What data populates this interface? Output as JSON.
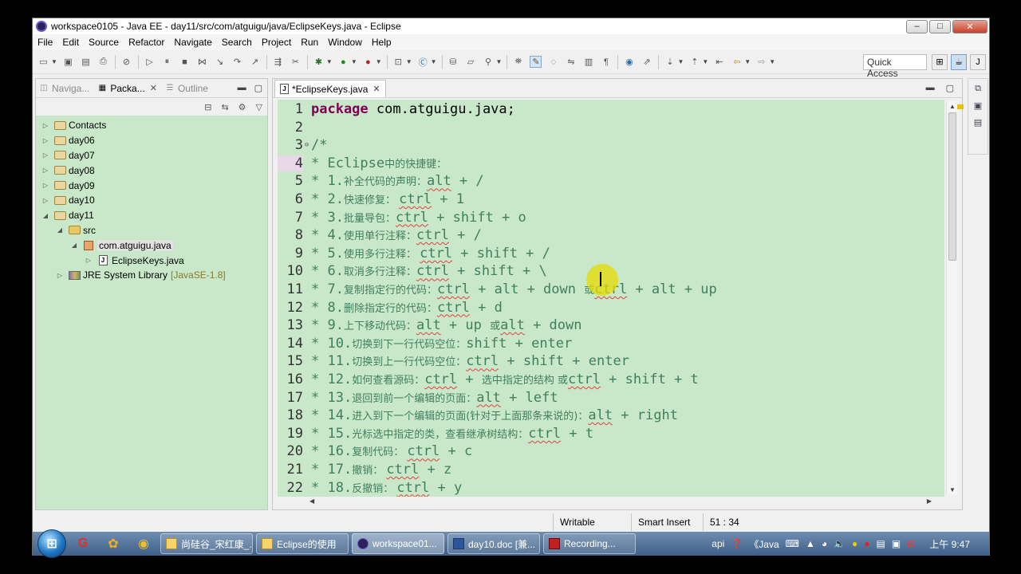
{
  "window": {
    "title": "workspace0105 - Java EE - day11/src/com/atguigu/java/EclipseKeys.java - Eclipse",
    "controls": [
      "–",
      "□",
      "✕"
    ]
  },
  "menu": [
    "File",
    "Edit",
    "Source",
    "Refactor",
    "Navigate",
    "Search",
    "Project",
    "Run",
    "Window",
    "Help"
  ],
  "toolbar": {
    "quick_access": "Quick Access"
  },
  "left_tabs": [
    {
      "label": "Naviga...",
      "icon": "navigator-icon",
      "active": false
    },
    {
      "label": "Packa...",
      "icon": "package-explorer-icon",
      "active": true
    },
    {
      "label": "Outline",
      "icon": "outline-icon",
      "active": false
    }
  ],
  "tree": [
    {
      "label": "Contacts",
      "type": "project",
      "twisty": "▷",
      "indent": 0
    },
    {
      "label": "day06",
      "type": "project",
      "twisty": "▷",
      "indent": 0
    },
    {
      "label": "day07",
      "type": "project",
      "twisty": "▷",
      "indent": 0
    },
    {
      "label": "day08",
      "type": "project",
      "twisty": "▷",
      "indent": 0
    },
    {
      "label": "day09",
      "type": "project",
      "twisty": "▷",
      "indent": 0
    },
    {
      "label": "day10",
      "type": "project",
      "twisty": "▷",
      "indent": 0
    },
    {
      "label": "day11",
      "type": "project",
      "twisty": "◢",
      "indent": 0
    },
    {
      "label": "src",
      "type": "folder",
      "twisty": "◢",
      "indent": 1
    },
    {
      "label": "com.atguigu.java",
      "type": "package",
      "twisty": "◢",
      "indent": 2,
      "selected": true
    },
    {
      "label": "EclipseKeys.java",
      "type": "java",
      "twisty": "▷",
      "indent": 3
    },
    {
      "label": "JRE System Library",
      "type": "library",
      "twisty": "▷",
      "indent": 1,
      "suffix": "[JavaSE-1.8]"
    }
  ],
  "editor": {
    "tab_label": "*EclipseKeys.java",
    "lines": [
      {
        "n": "1",
        "parts": [
          [
            "kw",
            "package"
          ],
          [
            "pl",
            " com.atguigu.java;"
          ]
        ]
      },
      {
        "n": "2",
        "parts": []
      },
      {
        "n": "3",
        "fold": "⊖",
        "parts": [
          [
            "c",
            "/*"
          ]
        ]
      },
      {
        "n": "4",
        "parts": [
          [
            "c",
            " * Eclipse"
          ],
          [
            "cj",
            "中的快捷键："
          ]
        ]
      },
      {
        "n": "5",
        "parts": [
          [
            "c",
            " * 1."
          ],
          [
            "cj",
            "补全代码的声明："
          ],
          [
            "sq",
            "alt"
          ],
          [
            "c",
            " + /"
          ]
        ]
      },
      {
        "n": "6",
        "parts": [
          [
            "c",
            " * 2."
          ],
          [
            "cj",
            "快速修复： "
          ],
          [
            "sq",
            "ctrl"
          ],
          [
            "c",
            " + 1"
          ]
        ]
      },
      {
        "n": "7",
        "parts": [
          [
            "c",
            " * 3."
          ],
          [
            "cj",
            "批量导包："
          ],
          [
            "sq",
            "ctrl"
          ],
          [
            "c",
            " + shift + o"
          ]
        ]
      },
      {
        "n": "8",
        "parts": [
          [
            "c",
            " * 4."
          ],
          [
            "cj",
            "使用单行注释："
          ],
          [
            "sq",
            "ctrl"
          ],
          [
            "c",
            " + /"
          ]
        ]
      },
      {
        "n": "9",
        "parts": [
          [
            "c",
            " * 5."
          ],
          [
            "cj",
            "使用多行注释： "
          ],
          [
            "sq",
            "ctrl"
          ],
          [
            "c",
            " + shift + /"
          ]
        ]
      },
      {
        "n": "10",
        "parts": [
          [
            "c",
            " * 6."
          ],
          [
            "cj",
            "取消多行注释："
          ],
          [
            "sq",
            "ctrl"
          ],
          [
            "c",
            " + shift + \\"
          ]
        ]
      },
      {
        "n": "11",
        "parts": [
          [
            "c",
            " * 7."
          ],
          [
            "cj",
            "复制指定行的代码："
          ],
          [
            "sq",
            "ctrl"
          ],
          [
            "c",
            " + alt + down "
          ],
          [
            "cj",
            "或"
          ],
          [
            "sq",
            "ctrl"
          ],
          [
            "c",
            " + alt + up"
          ]
        ]
      },
      {
        "n": "12",
        "parts": [
          [
            "c",
            " * 8."
          ],
          [
            "cj",
            "删除指定行的代码："
          ],
          [
            "sq",
            "ctrl"
          ],
          [
            "c",
            " + d"
          ]
        ]
      },
      {
        "n": "13",
        "parts": [
          [
            "c",
            " * 9."
          ],
          [
            "cj",
            "上下移动代码："
          ],
          [
            "sq",
            "alt"
          ],
          [
            "c",
            " + up  "
          ],
          [
            "cj",
            "或"
          ],
          [
            "sq",
            "alt"
          ],
          [
            "c",
            " + down"
          ]
        ]
      },
      {
        "n": "14",
        "parts": [
          [
            "c",
            " * 10."
          ],
          [
            "cj",
            "切换到下一行代码空位："
          ],
          [
            "c",
            "shift + enter"
          ]
        ]
      },
      {
        "n": "15",
        "parts": [
          [
            "c",
            " * 11."
          ],
          [
            "cj",
            "切换到上一行代码空位："
          ],
          [
            "sq",
            "ctrl"
          ],
          [
            "c",
            " + shift + enter"
          ]
        ]
      },
      {
        "n": "16",
        "parts": [
          [
            "c",
            " * 12."
          ],
          [
            "cj",
            "如何查看源码："
          ],
          [
            "sq",
            "ctrl"
          ],
          [
            "c",
            " + "
          ],
          [
            "cj",
            "选中指定的结构 或"
          ],
          [
            "sq",
            "ctrl"
          ],
          [
            "c",
            " + shift + t"
          ]
        ]
      },
      {
        "n": "17",
        "parts": [
          [
            "c",
            " * 13."
          ],
          [
            "cj",
            "退回到前一个编辑的页面："
          ],
          [
            "sq",
            "alt"
          ],
          [
            "c",
            " + left"
          ]
        ]
      },
      {
        "n": "18",
        "parts": [
          [
            "c",
            " * 14."
          ],
          [
            "cj",
            "进入到下一个编辑的页面(针对于上面那条来说的)："
          ],
          [
            "sq",
            "alt"
          ],
          [
            "c",
            " + right"
          ]
        ]
      },
      {
        "n": "19",
        "parts": [
          [
            "c",
            " * 15."
          ],
          [
            "cj",
            "光标选中指定的类，查看继承树结构："
          ],
          [
            "sq",
            "ctrl"
          ],
          [
            "c",
            " + t"
          ]
        ]
      },
      {
        "n": "20",
        "parts": [
          [
            "c",
            " * 16."
          ],
          [
            "cj",
            "复制代码： "
          ],
          [
            "sq",
            "ctrl"
          ],
          [
            "c",
            " + c"
          ]
        ]
      },
      {
        "n": "21",
        "parts": [
          [
            "c",
            " * 17."
          ],
          [
            "cj",
            "撤销： "
          ],
          [
            "sq",
            "ctrl"
          ],
          [
            "c",
            " + z"
          ]
        ]
      },
      {
        "n": "22",
        "parts": [
          [
            "c",
            " * 18."
          ],
          [
            "cj",
            "反撤销： "
          ],
          [
            "sq",
            "ctrl"
          ],
          [
            "c",
            " + y"
          ]
        ]
      }
    ]
  },
  "status": {
    "writable": "Writable",
    "insert_mode": "Smart Insert",
    "position": "51 : 34"
  },
  "taskbar": {
    "tasks": [
      {
        "label": "尚硅谷_宋红康_...",
        "active": false
      },
      {
        "label": "Eclipse的使用",
        "active": false
      },
      {
        "label": "workspace01...",
        "active": true
      },
      {
        "label": "day10.doc [兼...",
        "active": false
      },
      {
        "label": "Recording...",
        "active": false
      }
    ],
    "tray_text": "api",
    "tray_java": "《Java",
    "clock": "上午 9:47"
  }
}
